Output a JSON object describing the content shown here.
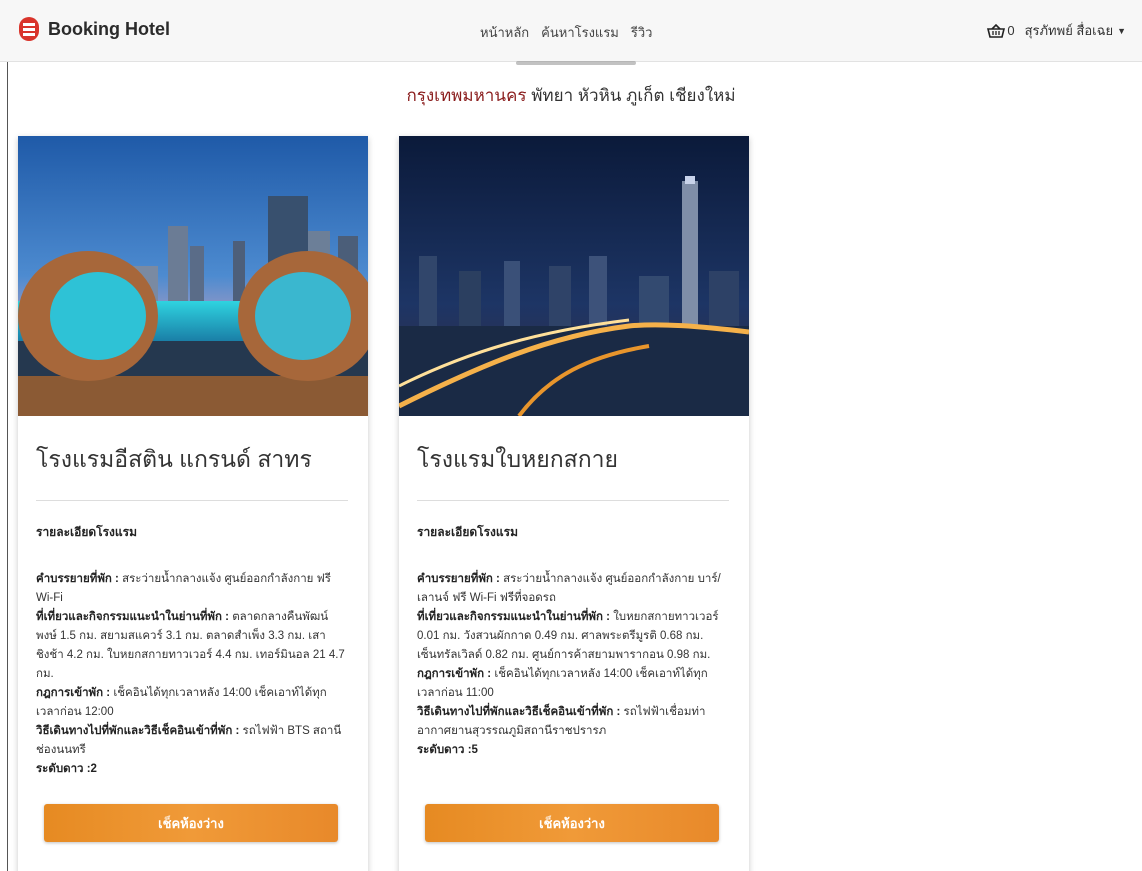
{
  "nav": {
    "brand": "Booking Hotel",
    "links": [
      "หน้าหลัก",
      "ค้นหาโรงแรม",
      "รีวิว"
    ],
    "cart_count": "0",
    "user_name": "สุรภัทพย์ สื่อเฉย",
    "brand_color": "#d9342b"
  },
  "cities": {
    "highlight": "กรุงเทพมหานคร",
    "rest": " พัทยา หัวหิน ภูเก็ต เชียงใหม่"
  },
  "hotels": [
    {
      "name": "โรงแรมอีสติน แกรนด์ สาทร",
      "detail_title": "รายละเอียดโรงแรม",
      "facilities_label": "คำบรรยายที่พัก :",
      "facilities": "สระว่ายน้ำกลางแจ้ง ศูนย์ออกกำลังกาย ฟรี Wi-Fi",
      "nearby_label": "ที่เที่ยวและกิจกรรมแนะนำในย่านที่พัก :",
      "nearby": "ตลาดกลางคืนพัฒน์พงษ์ 1.5 กม. สยามสแควร์ 3.1 กม. ตลาดสำเพ็ง 3.3 กม. เสาชิงช้า 4.2 กม. ใบหยกสกายทาวเวอร์ 4.4 กม. เทอร์มินอล 21 4.7 กม.",
      "rules_label": "กฎการเข้าพัก :",
      "rules": "เช็คอินได้ทุกเวลาหลัง 14:00 เช็คเอาท์ได้ทุกเวลาก่อน 12:00",
      "travel_label": "วิธีเดินทางไปที่พักและวิธีเช็คอินเข้าที่พัก :",
      "travel": "รถไฟฟ้า BTS สถานีช่องนนทรี",
      "stars_label": "ระดับดาว :",
      "stars": "2",
      "button": "เช็คห้องว่าง"
    },
    {
      "name": "โรงแรมใบหยกสกาย",
      "detail_title": "รายละเอียดโรงแรม",
      "facilities_label": "คำบรรยายที่พัก :",
      "facilities": "สระว่ายน้ำกลางแจ้ง ศูนย์ออกกำลังกาย บาร์/เลานจ์ ฟรี Wi-Fi ฟรีที่จอดรถ",
      "nearby_label": "ที่เที่ยวและกิจกรรมแนะนำในย่านที่พัก :",
      "nearby": "ใบหยกสกายทาวเวอร์ 0.01 กม. วังสวนผักกาด 0.49 กม. ศาลพระตรีมูรติ 0.68 กม. เซ็นทรัลเวิลด์ 0.82 กม. ศูนย์การค้าสยามพารากอน 0.98 กม.",
      "rules_label": "กฎการเข้าพัก :",
      "rules": "เช็คอินได้ทุกเวลาหลัง 14:00 เช็คเอาท์ได้ทุกเวลาก่อน 11:00",
      "travel_label": "วิธีเดินทางไปที่พักและวิธีเช็คอินเข้าที่พัก :",
      "travel": "รถไฟฟ้าเชื่อมท่าอากาศยานสุวรรณภูมิสถานีราชปรารภ",
      "stars_label": "ระดับดาว :",
      "stars": "5",
      "button": "เช็คห้องว่าง"
    }
  ],
  "colors": {
    "accent_orange": "#ee9533",
    "city_highlight": "#8a1c1c"
  }
}
